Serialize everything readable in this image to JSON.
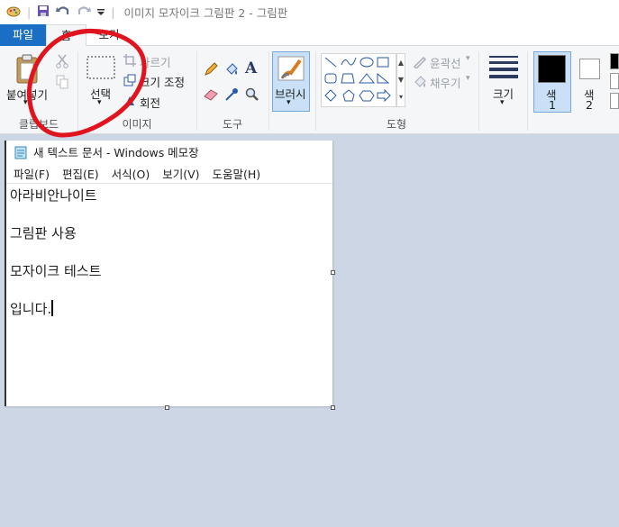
{
  "qat": {
    "title": "이미지 모자이크 그림판 2 - 그림판"
  },
  "tabs": {
    "file": "파일",
    "home": "홈",
    "view": "보기"
  },
  "ribbon": {
    "paste": "붙여넣기",
    "clipboard_group": "클립보드",
    "crop": "자르기",
    "resize": "크기 조정",
    "rotate": "회전",
    "select": "선택",
    "image_group": "이미지",
    "tools_group": "도구",
    "brushes": "브러시",
    "outline": "윤곽선",
    "fill": "채우기",
    "shapes_group": "도형",
    "size": "크기",
    "color1": "색",
    "color1_num": "1",
    "color2": "색",
    "color2_num": "2"
  },
  "notepad": {
    "title": "새 텍스트 문서 - Windows 메모장",
    "menu": [
      "파일(F)",
      "편집(E)",
      "서식(O)",
      "보기(V)",
      "도움말(H)"
    ],
    "lines": [
      "아라비안나이트",
      "그림판 사용",
      "모자이크 테스트",
      "입니다."
    ]
  },
  "colors": {
    "accent": "#1a6fc4",
    "annotation": "#e0141e",
    "canvas_bg": "#cdd6e5"
  }
}
